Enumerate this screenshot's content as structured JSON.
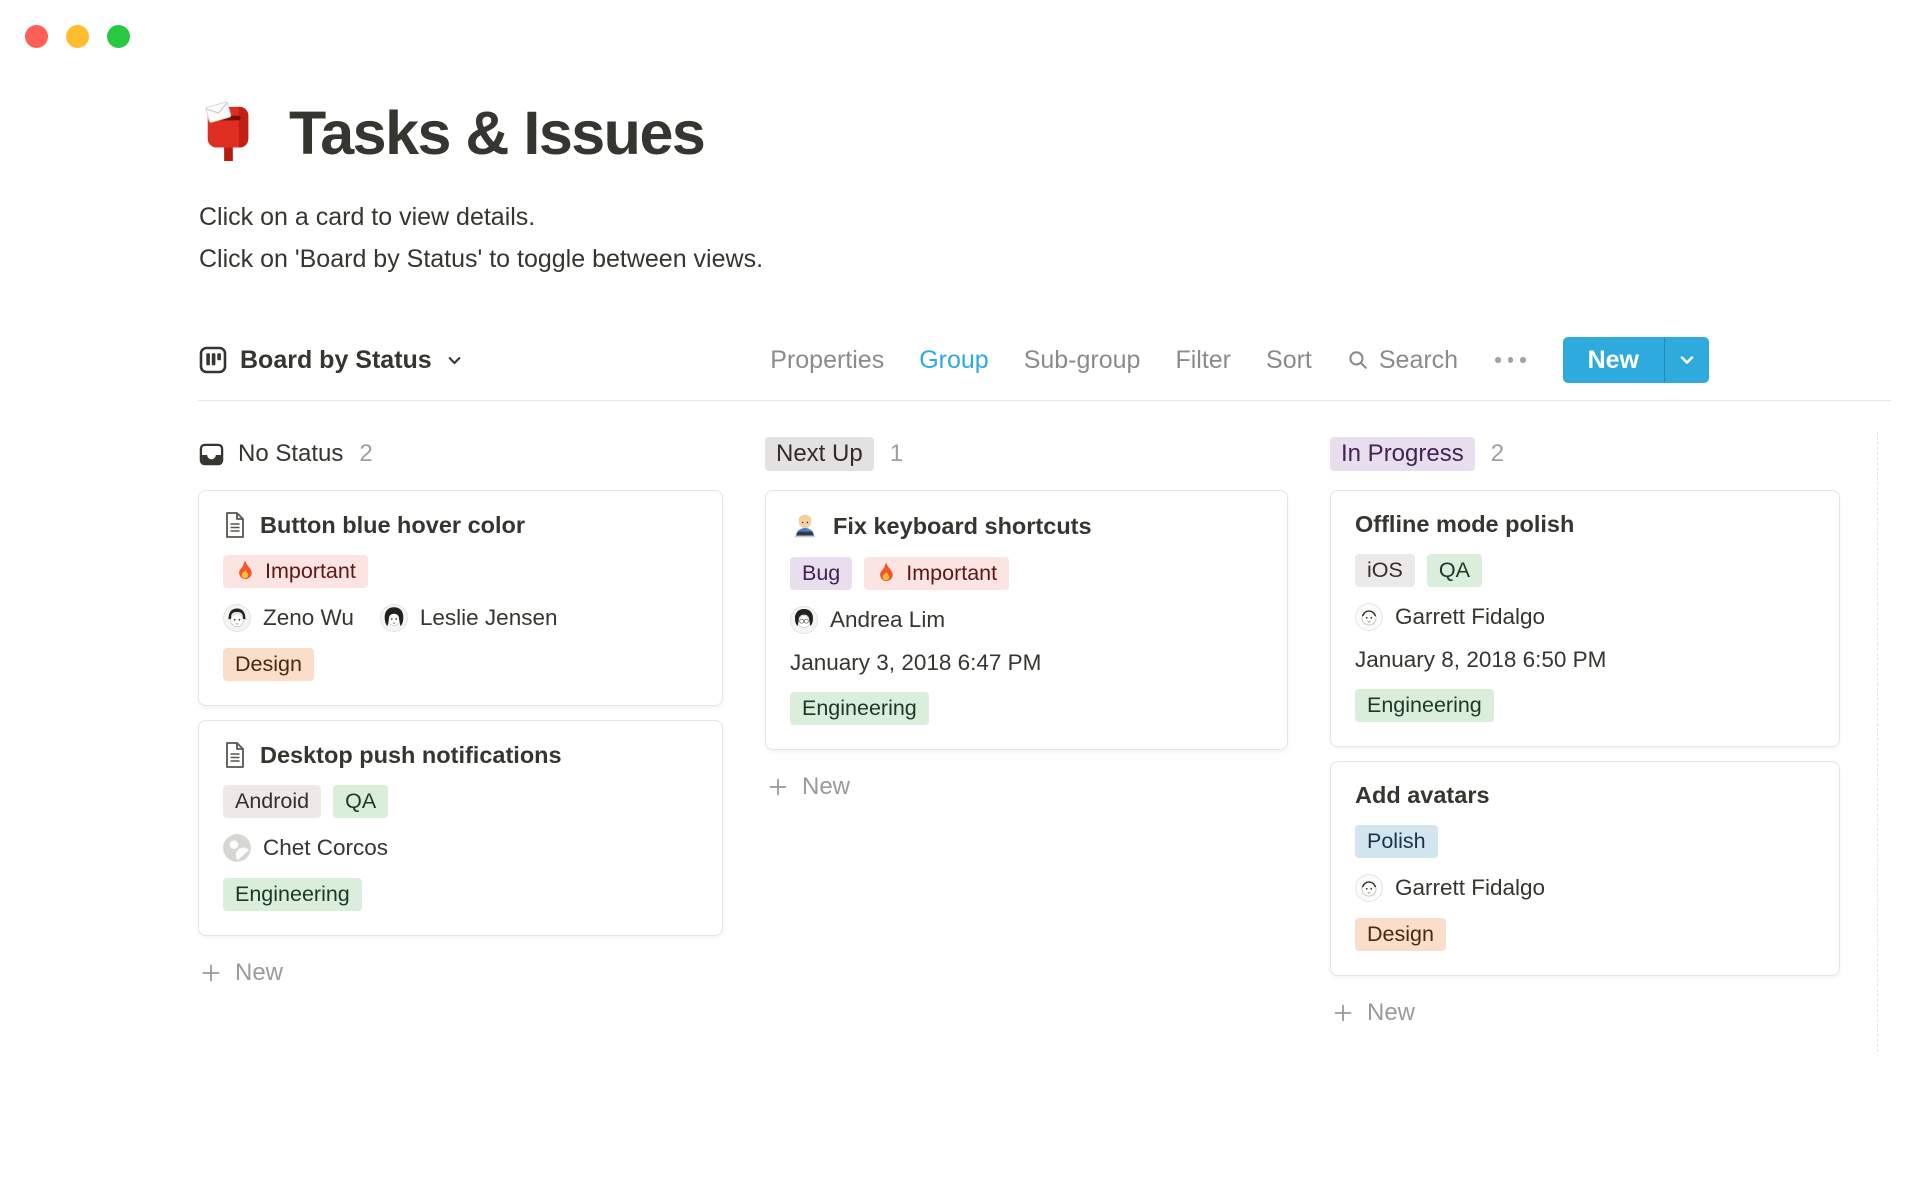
{
  "window": {
    "controls": [
      {
        "name": "close-button",
        "color": "#ff5f57"
      },
      {
        "name": "minimize-button",
        "color": "#febc2e"
      },
      {
        "name": "zoom-button",
        "color": "#28c840"
      }
    ]
  },
  "page": {
    "icon": "postbox-emoji",
    "title": "Tasks & Issues",
    "description": [
      "Click on a card to view details.",
      "Click on 'Board by Status' to toggle between views."
    ]
  },
  "toolbar": {
    "view": {
      "icon": "board-view-icon",
      "label": "Board by Status",
      "chevron": "chevron-down-icon"
    },
    "items": [
      {
        "label": "Properties",
        "active": false
      },
      {
        "label": "Group",
        "active": true
      },
      {
        "label": "Sub-group",
        "active": false
      },
      {
        "label": "Filter",
        "active": false
      },
      {
        "label": "Sort",
        "active": false
      }
    ],
    "search": {
      "icon": "search-icon",
      "label": "Search"
    },
    "more_icon": "ellipsis-icon",
    "new_button": {
      "label": "New",
      "chevron": "chevron-down-icon"
    }
  },
  "colors": {
    "accent_blue": "#2eaadc",
    "text": "#37352f",
    "muted_gray": "#9b9a97",
    "tag_red": {
      "bg": "#fbe4e1",
      "text": "#5d1715"
    },
    "tag_orange": {
      "bg": "#fadec9",
      "text": "#49290e"
    },
    "tag_green": {
      "bg": "#dbeddb",
      "text": "#1c3829"
    },
    "tag_gray": {
      "bg": "#ebeae8",
      "text": "#32302c"
    },
    "tag_purple": {
      "bg": "#e8deee",
      "text": "#412454"
    },
    "tag_blue": {
      "bg": "#d3e5ef",
      "text": "#183347"
    },
    "header_gray_badge": {
      "bg": "#e3e2e0",
      "text": "#2f2e2b"
    },
    "header_purple_badge": {
      "bg": "#e8deee",
      "text": "#412454"
    }
  },
  "board": {
    "columns": [
      {
        "label": "No Status",
        "count": "2",
        "header_style": "plain",
        "header_icon": "inbox-icon",
        "new_label": "New",
        "cards": [
          {
            "icon": "page-icon",
            "title": "Button blue hover color",
            "tags1": [
              {
                "label": "Important",
                "icon": "fire-emoji",
                "color": "red"
              }
            ],
            "people": [
              {
                "name": "Zeno Wu",
                "avatar": "zeno-wu-avatar"
              },
              {
                "name": "Leslie Jensen",
                "avatar": "leslie-jensen-avatar"
              }
            ],
            "tags2": [
              {
                "label": "Design",
                "color": "orange"
              }
            ]
          },
          {
            "icon": "page-icon",
            "title": "Desktop push notifications",
            "tags1": [
              {
                "label": "Android",
                "color": "gray"
              },
              {
                "label": "QA",
                "color": "green"
              }
            ],
            "people": [
              {
                "name": "Chet Corcos",
                "avatar": "default-person-avatar"
              }
            ],
            "tags2": [
              {
                "label": "Engineering",
                "color": "green"
              }
            ]
          }
        ]
      },
      {
        "label": "Next Up",
        "count": "1",
        "header_style": "gray-badge",
        "new_label": "New",
        "cards": [
          {
            "icon": "technologist-emoji",
            "title": "Fix keyboard shortcuts",
            "tags1": [
              {
                "label": "Bug",
                "color": "purple"
              },
              {
                "label": "Important",
                "icon": "fire-emoji",
                "color": "red"
              }
            ],
            "people": [
              {
                "name": "Andrea Lim",
                "avatar": "andrea-lim-avatar"
              }
            ],
            "date": "January 3, 2018 6:47 PM",
            "tags2": [
              {
                "label": "Engineering",
                "color": "green"
              }
            ]
          }
        ]
      },
      {
        "label": "In Progress",
        "count": "2",
        "header_style": "purple-badge",
        "new_label": "New",
        "cards": [
          {
            "title": "Offline mode polish",
            "tags1": [
              {
                "label": "iOS",
                "color": "gray"
              },
              {
                "label": "QA",
                "color": "green"
              }
            ],
            "people": [
              {
                "name": "Garrett Fidalgo",
                "avatar": "garrett-fidalgo-avatar"
              }
            ],
            "date": "January 8, 2018 6:50 PM",
            "tags2": [
              {
                "label": "Engineering",
                "color": "green"
              }
            ]
          },
          {
            "title": "Add avatars",
            "tags1": [
              {
                "label": "Polish",
                "color": "blue"
              }
            ],
            "people": [
              {
                "name": "Garrett Fidalgo",
                "avatar": "garrett-fidalgo-avatar"
              }
            ],
            "tags2": [
              {
                "label": "Design",
                "color": "orange"
              }
            ]
          }
        ]
      }
    ]
  }
}
